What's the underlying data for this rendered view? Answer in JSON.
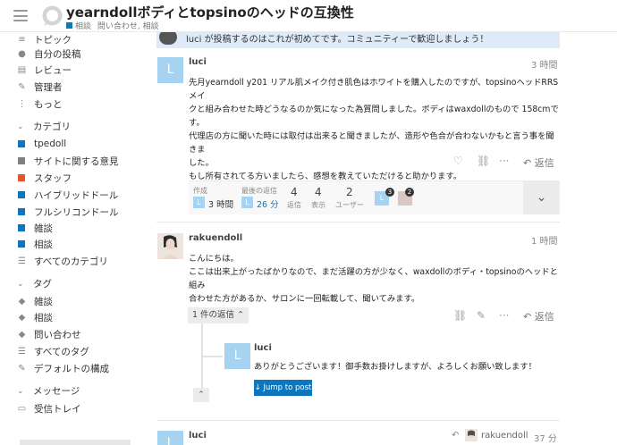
{
  "header": {
    "title": "yearndollボディとtopsinoのヘッドの互換性",
    "category": "相談",
    "tags": "問い合わせ, 相談"
  },
  "sidebar": {
    "top_items": [
      {
        "label": "トピック",
        "icon": "topics-icon"
      },
      {
        "label": "自分の投稿",
        "icon": "user-icon"
      },
      {
        "label": "レビュー",
        "icon": "review-icon"
      },
      {
        "label": "管理者",
        "icon": "wrench-icon"
      },
      {
        "label": "もっと",
        "icon": "more-icon"
      }
    ],
    "categories_heading": "カテゴリ",
    "categories": [
      {
        "label": "tpedoll",
        "color": "#0e76bd"
      },
      {
        "label": "サイトに関する意見",
        "color": "#808281"
      },
      {
        "label": "スタッフ",
        "color": "#e45735"
      },
      {
        "label": "ハイブリッドドール",
        "color": "#0e76bd"
      },
      {
        "label": "フルシリコンドール",
        "color": "#0e76bd"
      },
      {
        "label": "雑談",
        "color": "#0e76bd"
      },
      {
        "label": "相談",
        "color": "#0e76bd"
      }
    ],
    "all_categories": "すべてのカテゴリ",
    "tags_heading": "タグ",
    "tags": [
      "雑談",
      "相談",
      "問い合わせ"
    ],
    "all_tags": "すべてのタグ",
    "default_config": "デフォルトの構成",
    "messages_heading": "メッセージ",
    "inbox": "受信トレイ"
  },
  "notice": "luci が投稿するのはこれが初めてです。コミュニティーで歓迎しましょう！",
  "post1": {
    "avatar": "L",
    "username": "luci",
    "time": "3 時間",
    "lines": [
      "先月yearndoll y201 リアル肌メイク付き肌色はホワイトを購入したのですが、topsinoヘッドRRSメイ",
      "クと組み合わせた時どうなるのか気になった為質問しました。ボディはwaxdollのもので 158cmです。",
      "代理店の方に聞いた時には取付は出来ると聞きましたが、造形や色合が合わないかもと言う事を聞きま",
      "した。",
      "もし所有されてる方いましたら、感想を教えていただけると助かります。"
    ],
    "reply_label": "返信",
    "stats": {
      "created_label": "作成",
      "created_value": "3 時間",
      "last_reply_label": "最後の返信",
      "last_reply_value": "26 分",
      "replies_count": "4",
      "replies_label": "返信",
      "views_count": "4",
      "views_label": "表示",
      "users_count": "2",
      "users_label": "ユーザー",
      "badge1": "3",
      "badge2": "2"
    }
  },
  "post2": {
    "username": "rakuendoll",
    "time": "1 時間",
    "lines": [
      "こんにちは。",
      "ここは出来上がったばかりなので、まだ活躍の方が少なく、waxdollのボディ・topsinoのヘッドと組み",
      "合わせた方があるか、サロンに一回転載して、聞いてみます。"
    ],
    "replies_toggle": "1 件の返信",
    "reply_label": "返信"
  },
  "nested_reply": {
    "avatar": "L",
    "username": "luci",
    "text": "ありがとうございます！御手数お掛けしますが、よろしくお願い致します！",
    "jump_label": "Jump to post"
  },
  "post3": {
    "avatar": "L",
    "username": "luci",
    "reply_to": "rakuendoll",
    "time": "37 分"
  }
}
